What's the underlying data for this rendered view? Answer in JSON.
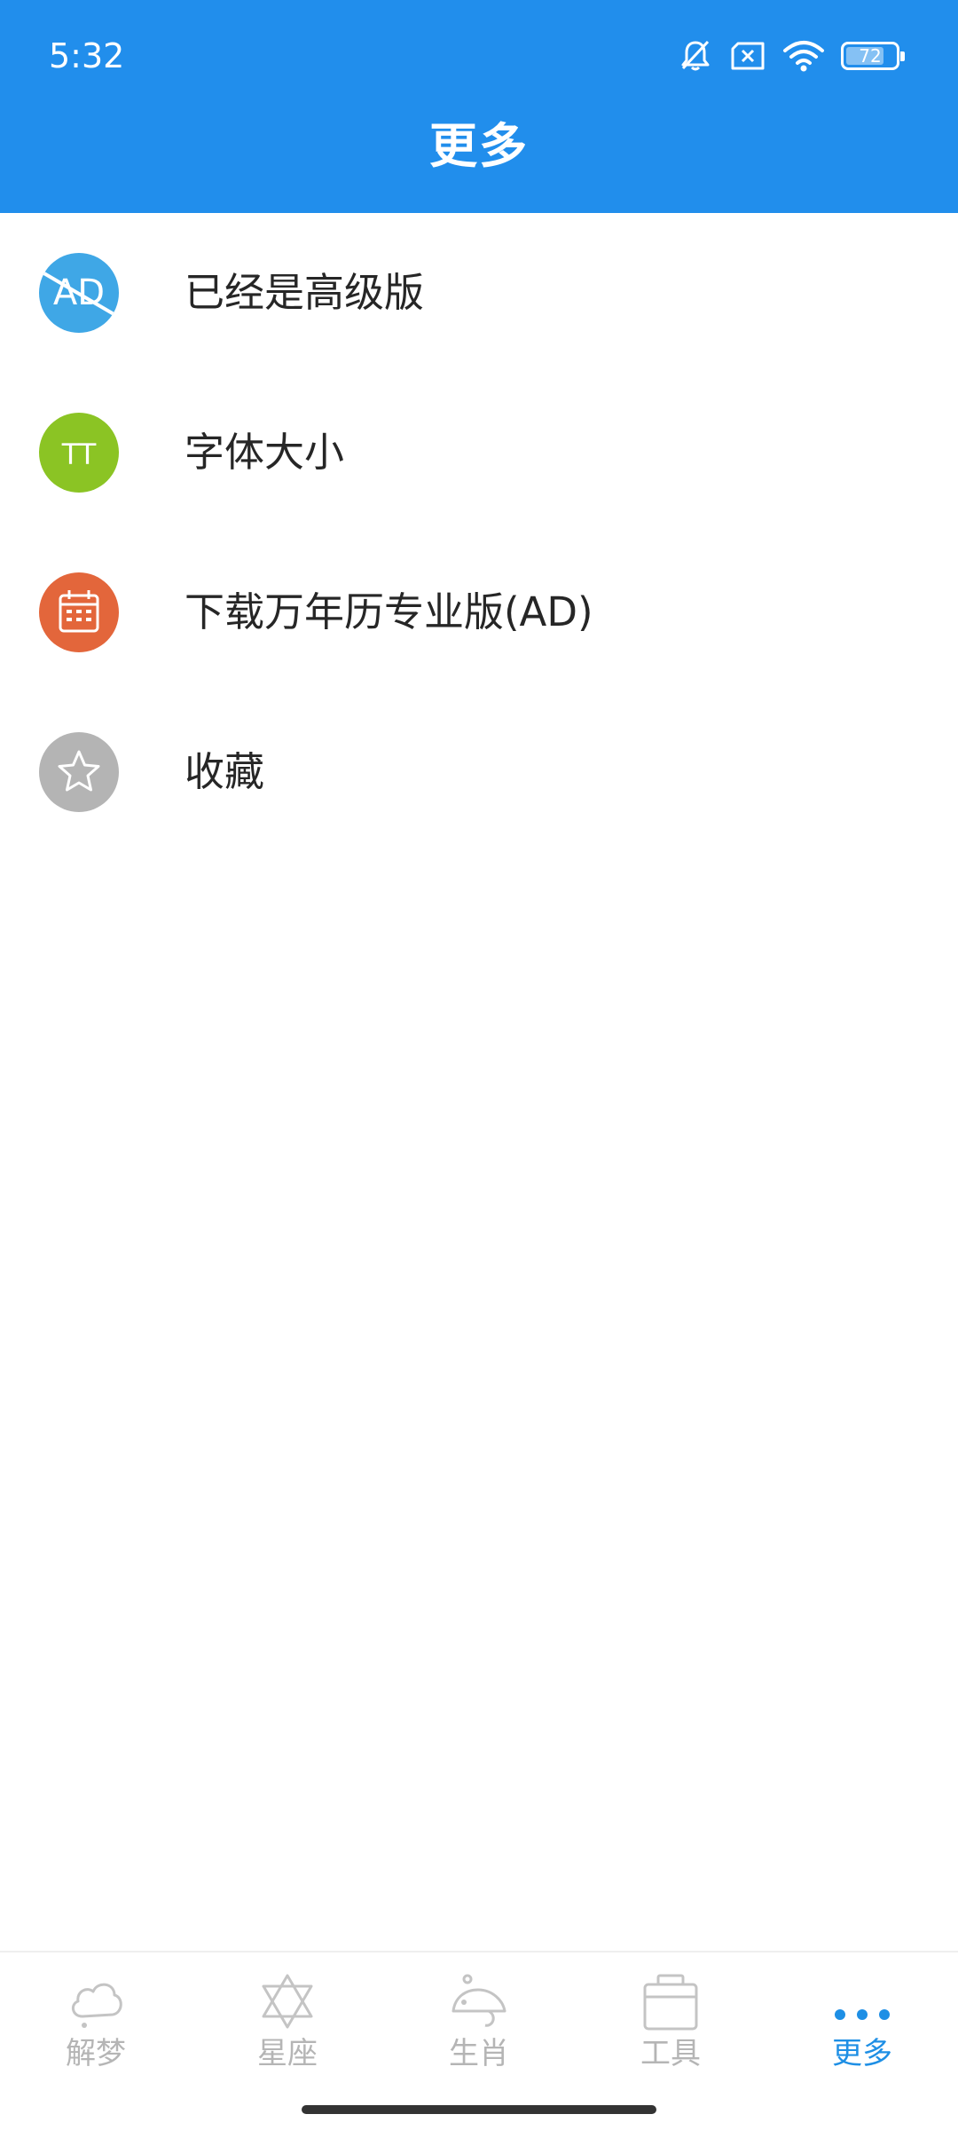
{
  "status_bar": {
    "time": "5:32",
    "battery_level": "72",
    "icons": [
      "bell-off-icon",
      "sim-error-icon",
      "wifi-icon",
      "battery-icon"
    ]
  },
  "header": {
    "title": "更多",
    "background_color": "#218EEC"
  },
  "menu": {
    "items": [
      {
        "label": "已经是高级版",
        "icon": "ad-free-icon",
        "icon_text": "AD",
        "color": "#3FA7E6"
      },
      {
        "label": "字体大小",
        "icon": "font-size-icon",
        "icon_text": "TT",
        "color": "#8BC424"
      },
      {
        "label": "下载万年历专业版(AD)",
        "icon": "calendar-icon",
        "color": "#E3663B"
      },
      {
        "label": "收藏",
        "icon": "star-icon",
        "color": "#B4B4B4"
      }
    ]
  },
  "bottom_nav": {
    "items": [
      {
        "label": "解梦",
        "icon": "cloud-icon",
        "active": false
      },
      {
        "label": "星座",
        "icon": "hexagram-icon",
        "active": false
      },
      {
        "label": "生肖",
        "icon": "rat-icon",
        "active": false
      },
      {
        "label": "工具",
        "icon": "toolbox-icon",
        "active": false
      },
      {
        "label": "更多",
        "icon": "more-dots-icon",
        "active": true
      }
    ],
    "active_color": "#1E8FE5",
    "inactive_color": "#B5B5B5"
  }
}
